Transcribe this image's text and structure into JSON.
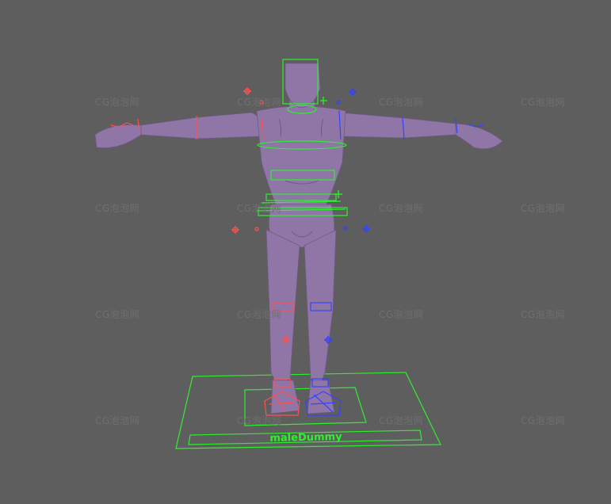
{
  "viewport": {
    "background": "#5e5e5e",
    "asset_label": "maleDummy",
    "watermark_text": "CG泡泡网"
  },
  "colors": {
    "body": "#8f76a6",
    "body_shade": "#6f5a86",
    "control_main": "#2ef02e",
    "control_left": "#ff5050",
    "control_right": "#3344ff"
  },
  "icons": {
    "ik_handle": "crosshair-circle-icon",
    "pole_vector": "plus-target-icon"
  }
}
